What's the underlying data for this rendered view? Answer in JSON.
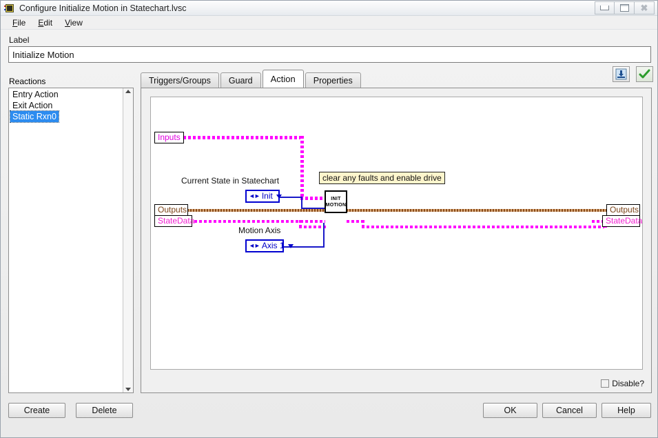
{
  "window": {
    "title": "Configure Initialize Motion in Statechart.lvsc",
    "icon": "labview-vi-icon",
    "controls": {
      "minimize": "minimize-icon",
      "maximize": "maximize-icon",
      "close": "close-icon"
    }
  },
  "menubar": {
    "items": [
      {
        "label": "File",
        "accel": "F"
      },
      {
        "label": "Edit",
        "accel": "E"
      },
      {
        "label": "View",
        "accel": "V"
      }
    ]
  },
  "label_section": {
    "caption": "Label",
    "value": "Initialize Motion",
    "placeholder": ""
  },
  "reactions": {
    "caption": "Reactions",
    "items": [
      {
        "label": "Entry Action",
        "selected": false
      },
      {
        "label": "Exit Action",
        "selected": false
      },
      {
        "label": "Static Rxn0",
        "selected": true
      }
    ],
    "scrollbar": {
      "up": "scroll-up-arrow-icon",
      "down": "scroll-down-arrow-icon"
    }
  },
  "tabs": [
    {
      "label": "Triggers/Groups",
      "active": false
    },
    {
      "label": "Guard",
      "active": false
    },
    {
      "label": "Action",
      "active": true
    },
    {
      "label": "Properties",
      "active": false
    }
  ],
  "toolbar": {
    "save_icon": "save-to-disk-icon",
    "run_icon": "green-checkmark-icon"
  },
  "diagram": {
    "terminals": {
      "inputs_left": "Inputs",
      "outputs_left": "Outputs",
      "statedata_left": "StateData",
      "outputs_right": "Outputs",
      "statedata_right": "StateData"
    },
    "labels": {
      "current_state": "Current State in Statechart",
      "motion_axis": "Motion Axis"
    },
    "controls": {
      "current_state_value": "Init",
      "motion_axis_value": "Axis 1"
    },
    "comment": "clear any faults and enable drive",
    "subvi": {
      "line1": "INIT",
      "line2": "MOTION"
    },
    "colors": {
      "inputs_wire": "#ff00ff",
      "statedata_wire": "#ff00ff",
      "outputs_wire": "#8a4b1a",
      "enum_wire": "#1818c8"
    }
  },
  "disable": {
    "label": "Disable?",
    "checked": false
  },
  "buttons": {
    "create": "Create",
    "delete": "Delete",
    "ok": "OK",
    "cancel": "Cancel",
    "help": "Help"
  }
}
